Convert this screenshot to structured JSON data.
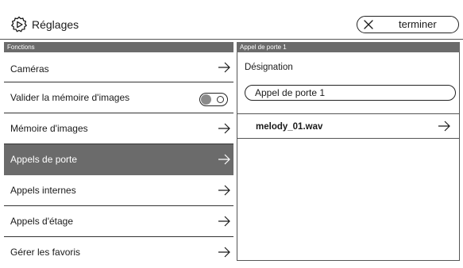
{
  "header": {
    "icon": "gear-play-icon",
    "title": "Réglages",
    "done_label": "terminer",
    "done_icon": "close-icon"
  },
  "left_panel": {
    "section_title": "Fonctions",
    "items": [
      {
        "label": "Caméras",
        "control": "arrow"
      },
      {
        "label": "Valider la mémoire d'images",
        "control": "toggle",
        "toggle_on": false
      },
      {
        "label": "Mémoire d'images",
        "control": "arrow"
      },
      {
        "label": "Appels de porte",
        "control": "arrow",
        "selected": true
      },
      {
        "label": "Appels internes",
        "control": "arrow"
      },
      {
        "label": "Appels d'étage",
        "control": "arrow"
      },
      {
        "label": "Gérer les favoris",
        "control": "arrow"
      }
    ]
  },
  "right_panel": {
    "section_title": "Appel de porte 1",
    "designation_label": "Désignation",
    "designation_value": "Appel de porte 1",
    "ringtone": {
      "label": "melody_01.wav",
      "icon": "arrow-right-icon"
    }
  },
  "colors": {
    "selected_bg": "#6b6b6b",
    "section_header_bg": "#6b6b6b",
    "text": "#1a1a1a",
    "border": "#333333"
  }
}
